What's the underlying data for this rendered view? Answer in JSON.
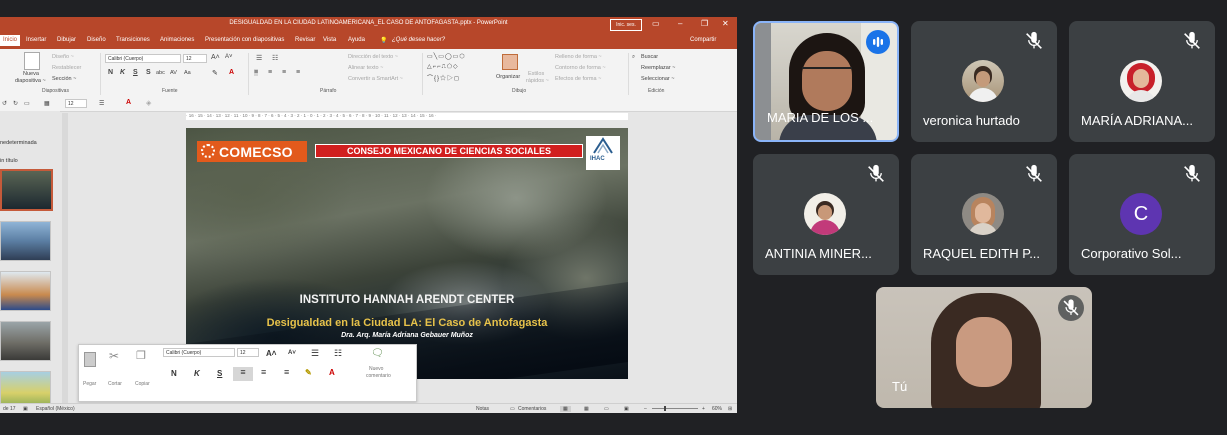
{
  "powerpoint": {
    "window_title": "DESIGUALDAD EN LA CIUDAD LATINOAMERICANA_EL CASO DE ANTOFAGASTA.pptx - PowerPoint",
    "signin_label": "Inic. ses.",
    "tabs": [
      "Inicio",
      "Insertar",
      "Dibujar",
      "Diseño",
      "Transiciones",
      "Animaciones",
      "Presentación con diapositivas",
      "Revisar",
      "Vista",
      "Ayuda"
    ],
    "tell_me": "¿Qué desea hacer?",
    "share": "Compartir",
    "ribbon": {
      "diseno": "Diseño ~",
      "restablecer": "Restablecer",
      "seccion": "Sección ~",
      "nueva": "Nueva",
      "diapositiva": "diapositiva ~",
      "group_diapositivas": "Diapositivas",
      "font_name": "Calibri (Cuerpo)",
      "font_size": "12",
      "group_fuente": "Fuente",
      "direccion": "Dirección del texto ~",
      "alinear": "Alinear texto ~",
      "smartart": "Convertir a SmartArt ~",
      "group_parrafo": "Párrafo",
      "organizar": "Organizar",
      "estilos": "Estilos",
      "rapidos": "rápidos ~",
      "relleno": "Relleno de forma ~",
      "contorno": "Contorno de forma ~",
      "efectos": "Efectos de forma ~",
      "group_dibujo": "Dibujo",
      "buscar": "Buscar",
      "reemplazar": "Reemplazar ~",
      "seleccionar": "Seleccionar ~",
      "group_edicion": "Edición"
    },
    "qat_size": "12",
    "ruler_text": "· 16 · 15 · 14 · 13 · 12 · 11 · 10 · 9 · 8 · 7 · 6 · 5 · 4 · 3 · 2 · 1 · 0 · 1 · 2 · 3 · 4 · 5 · 6 · 7 · 8 · 9 · 10 · 11 · 12 · 13 · 14 · 15 · 16 ·",
    "sections": {
      "predeterminada": "nedeterminada",
      "sin_titulo": "in título"
    },
    "slide": {
      "comecso": "COMECSO",
      "consejo": "CONSEJO MEXICANO DE CIENCIAS SOCIALES",
      "ihac": "IHAC",
      "instituto": "INSTITUTO HANNAH ARENDT CENTER",
      "desigualdad": "Desigualdad en la Ciudad LA: El Caso de Antofagasta",
      "autor": "Dra. Arq. María Adriana Gebauer Muñoz"
    },
    "mini_toolbar": {
      "font": "Calibri (Cuerpo)",
      "size": "12",
      "pegar": "Pegar",
      "cortar": "Cortar",
      "copiar": "Copiar",
      "bold": "N",
      "italic": "K",
      "underline": "S",
      "nuevo": "Nuevo",
      "comentario": "comentario"
    },
    "status": {
      "slide": "de 17",
      "language": "Español (México)",
      "notas": "Notas",
      "comentarios": "Comentarios",
      "zoom": "60%"
    }
  },
  "participants": [
    {
      "name": "MARIA DE LOS ...",
      "speaking": true
    },
    {
      "name": "veronica hurtado",
      "muted": true
    },
    {
      "name": "MARÍA ADRIANA...",
      "muted": true
    },
    {
      "name": "ANTINIA MINER...",
      "muted": true
    },
    {
      "name": "RAQUEL EDITH P...",
      "muted": true
    },
    {
      "name": "Corporativo Sol...",
      "muted": true,
      "initial": "C",
      "avatar_color": "#5e35b1"
    },
    {
      "name": "Tú",
      "muted": true
    }
  ]
}
